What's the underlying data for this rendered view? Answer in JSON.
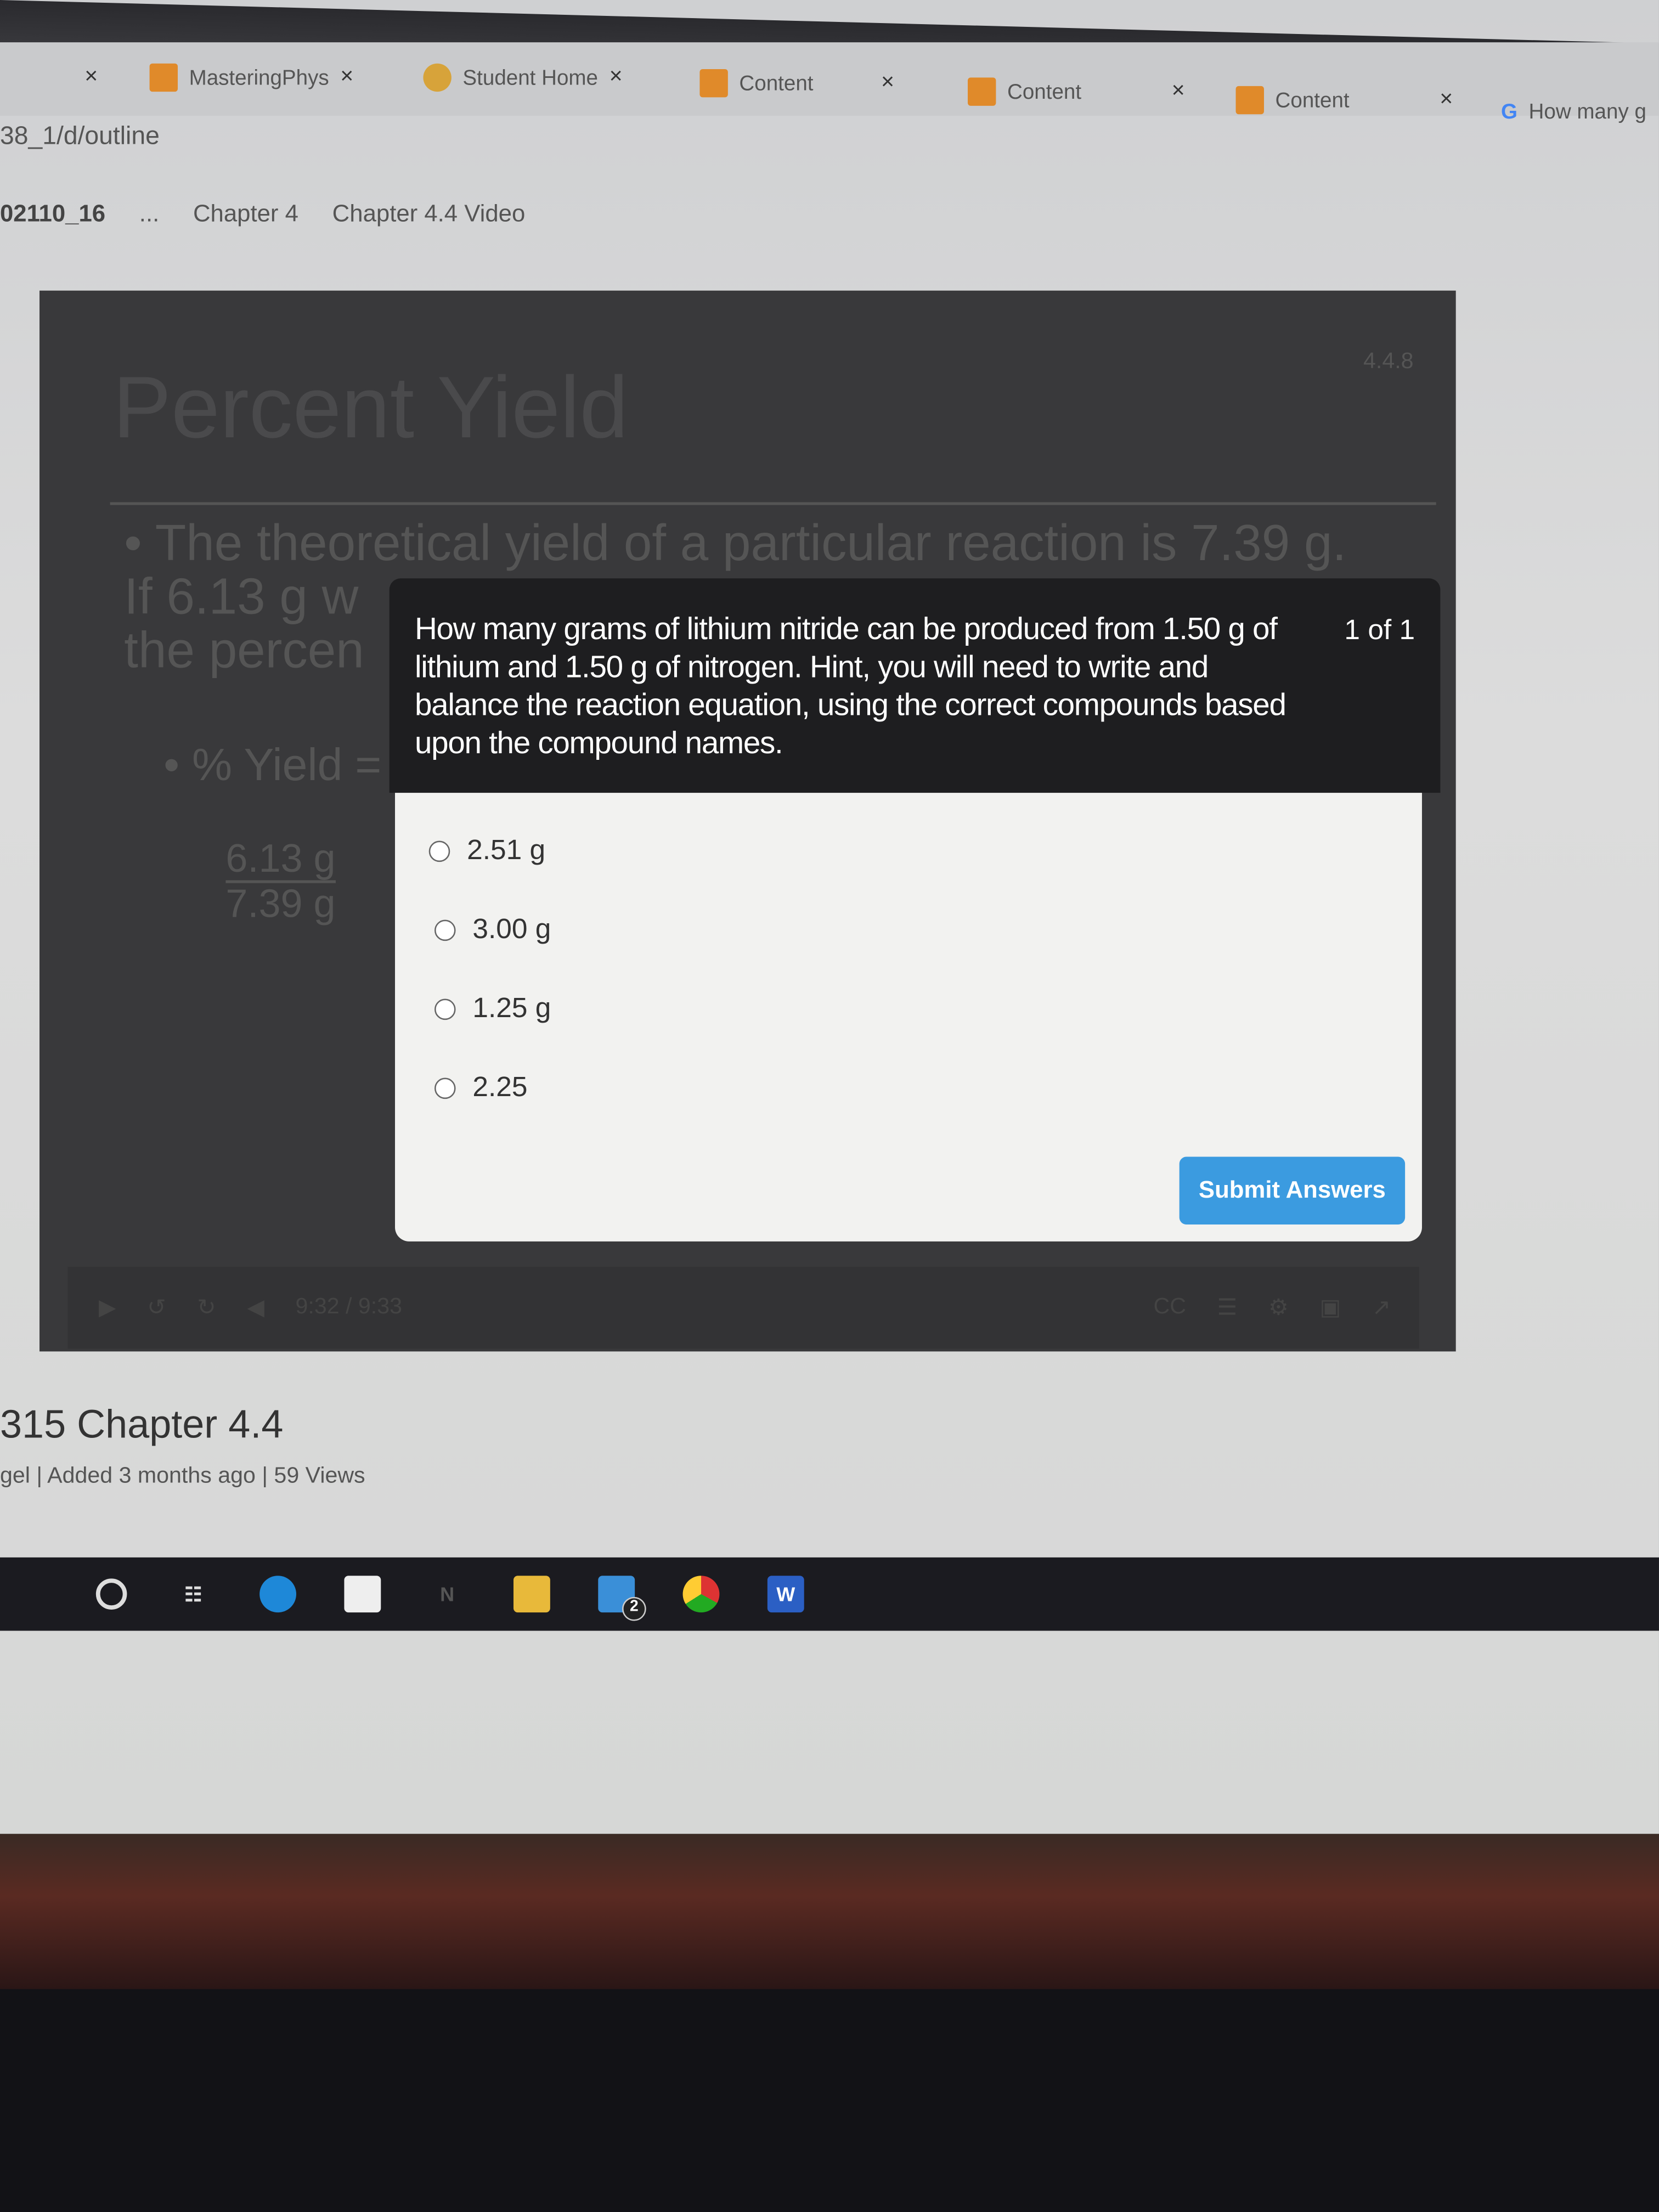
{
  "browser": {
    "tabs": [
      {
        "label": "MasteringPhys",
        "icon": "mastering-icon"
      },
      {
        "label": "Student Home",
        "icon": "dots-icon"
      },
      {
        "label": "Content",
        "icon": "pencil-icon"
      },
      {
        "label": "Content",
        "icon": "pencil-icon"
      },
      {
        "label": "Content",
        "icon": "pencil-icon"
      },
      {
        "label": "How many g",
        "icon": "google-icon"
      }
    ],
    "close_glyph": "×",
    "address": "38_1/d/outline"
  },
  "breadcrumb": [
    "02110_16",
    "...",
    "Chapter 4",
    "Chapter 4.4 Video"
  ],
  "video": {
    "slide_title": "Percent Yield",
    "slide_number": "4.4.8",
    "slide_text_line1": "• The theoretical yield of a particular reaction is 7.39 g.",
    "slide_text_line2": "If 6.13 g w",
    "slide_text_line3": "the percen",
    "slide_yield": "• % Yield =",
    "slide_numerator": "6.13 g",
    "slide_denominator": "7.39 g",
    "time": "9:32 / 9:33",
    "cc_label": "CC"
  },
  "quiz": {
    "question": "How many grams of lithium nitride can be produced from 1.50 g of lithium and 1.50 g of nitrogen. Hint, you will need to write and balance the reaction equation, using the correct compounds based upon the compound names.",
    "count": "1 of 1",
    "options": [
      "2.51 g",
      "3.00 g",
      "1.25 g",
      "2.25"
    ],
    "submit_label": "Submit Answers",
    "accent": "#3b9be0"
  },
  "page": {
    "title": "315 Chapter 4.4",
    "meta": "gel  |  Added 3 months ago  |  59 Views"
  },
  "taskbar": {
    "mail_badge": "2",
    "word_label": "W"
  }
}
